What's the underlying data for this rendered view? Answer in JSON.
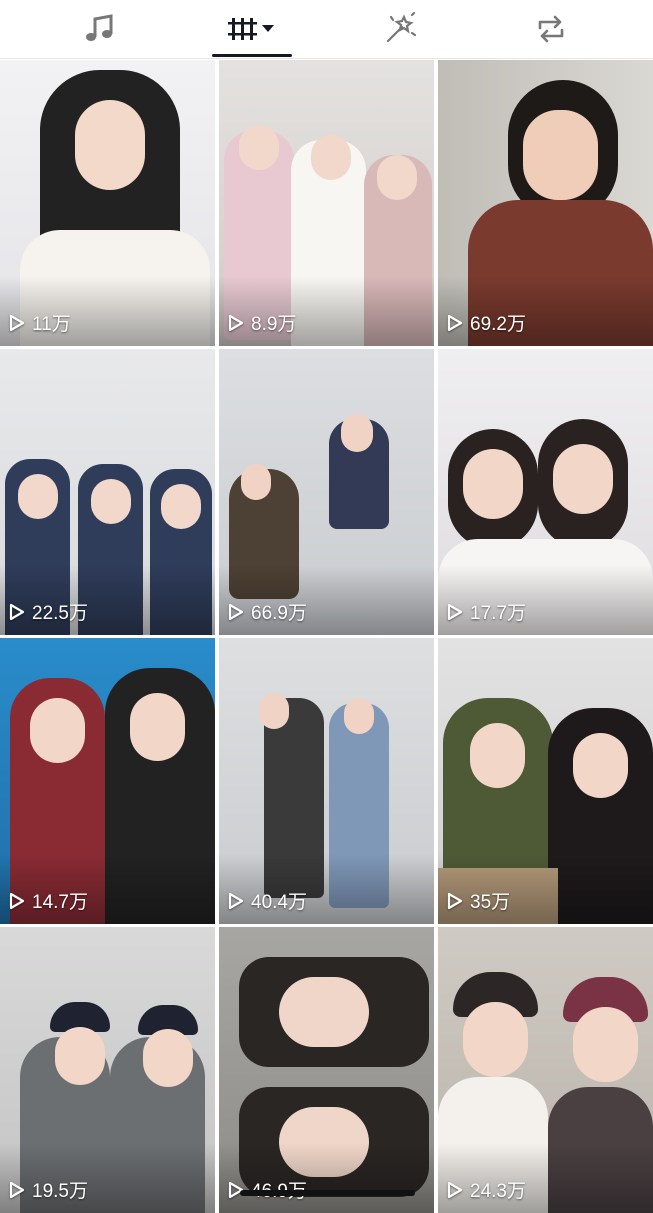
{
  "tabs": [
    {
      "name": "music",
      "icon": "music-note-icon"
    },
    {
      "name": "videos",
      "icon": "video-grid-icon",
      "active": true
    },
    {
      "name": "favorites",
      "icon": "magic-wand-icon"
    },
    {
      "name": "reposts",
      "icon": "repost-icon"
    }
  ],
  "videos": [
    {
      "views": "11万",
      "theme": "#ededf0"
    },
    {
      "views": "8.9万",
      "theme": "#d9d6d3"
    },
    {
      "views": "69.2万",
      "theme": "#c8c7c2"
    },
    {
      "views": "22.5万",
      "theme": "#dfe0e2"
    },
    {
      "views": "66.9万",
      "theme": "#d7d9dc"
    },
    {
      "views": "17.7万",
      "theme": "#e6e4e6"
    },
    {
      "views": "14.7万",
      "theme": "#2f8fc8"
    },
    {
      "views": "40.4万",
      "theme": "#d4d6d8"
    },
    {
      "views": "35万",
      "theme": "#d8d8d8"
    },
    {
      "views": "19.5万",
      "theme": "#cfd0cf"
    },
    {
      "views": "46.9万",
      "theme": "#9e9c99"
    },
    {
      "views": "24.3万",
      "theme": "#c9c4bd"
    }
  ]
}
